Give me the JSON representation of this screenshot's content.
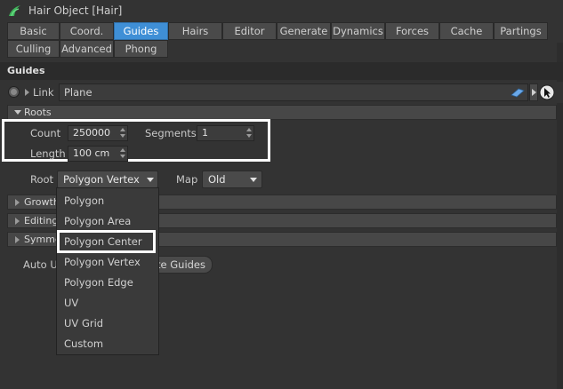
{
  "window": {
    "title": "Hair Object [Hair]"
  },
  "tabs_row1": [
    "Basic",
    "Coord.",
    "Guides",
    "Hairs",
    "Editor",
    "Generate",
    "Dynamics",
    "Forces",
    "Cache",
    "Partings"
  ],
  "tabs_row2": [
    "Culling",
    "Advanced",
    "Phong"
  ],
  "active_tab": "Guides",
  "section": {
    "title": "Guides"
  },
  "link": {
    "label": "Link",
    "value": "Plane"
  },
  "roots": {
    "title": "Roots",
    "count_label": "Count",
    "count_value": "250000",
    "segments_label": "Segments",
    "segments_value": "1",
    "length_label": "Length",
    "length_value": "100 cm",
    "root_label": "Root",
    "root_value": "Polygon Vertex",
    "map_label": "Map",
    "map_value": "Old"
  },
  "groups": {
    "growth": "Growth",
    "editing": "Editing",
    "symmetry": "Symme"
  },
  "auto": {
    "label": "Auto U",
    "button_label": "te Guides"
  },
  "root_menu": {
    "options": [
      "Polygon",
      "Polygon Area",
      "Polygon Center",
      "Polygon Vertex",
      "Polygon Edge",
      "UV",
      "UV Grid",
      "Custom"
    ],
    "highlighted": "Polygon Center"
  },
  "colors": {
    "active_tab": "#3f8fd6",
    "background": "#333333",
    "highlight_box": "#ffffff"
  }
}
